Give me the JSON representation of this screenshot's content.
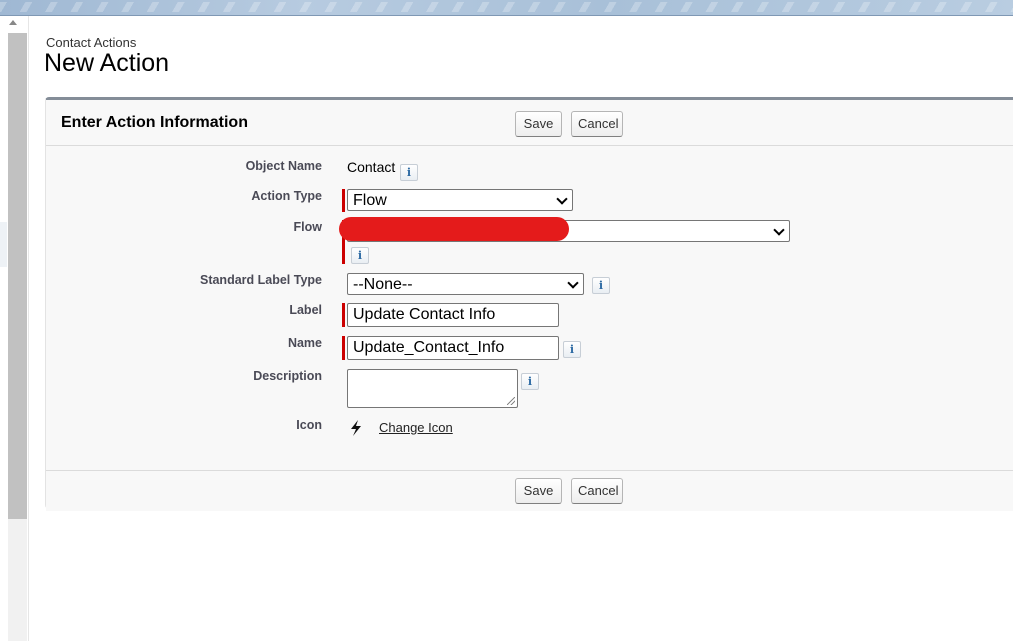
{
  "breadcrumb": "Contact Actions",
  "title": "New Action",
  "section": {
    "title": "Enter Action Information",
    "save_label": "Save",
    "cancel_label": "Cancel"
  },
  "fields": {
    "object_name": {
      "label": "Object Name",
      "value": "Contact"
    },
    "action_type": {
      "label": "Action Type",
      "value": "Flow"
    },
    "flow": {
      "label": "Flow",
      "value": ""
    },
    "standard_label_type": {
      "label": "Standard Label Type",
      "value": "--None--"
    },
    "label": {
      "label": "Label",
      "value": "Update Contact Info"
    },
    "name": {
      "label": "Name",
      "value": "Update_Contact_Info"
    },
    "description": {
      "label": "Description",
      "value": ""
    },
    "icon": {
      "label": "Icon",
      "link": "Change Icon",
      "icon_name": "lightning-bolt-icon"
    }
  },
  "info_glyph": "i",
  "colors": {
    "required": "#cc0000",
    "redaction": "#e41b1b",
    "panel_border": "#848d98"
  }
}
